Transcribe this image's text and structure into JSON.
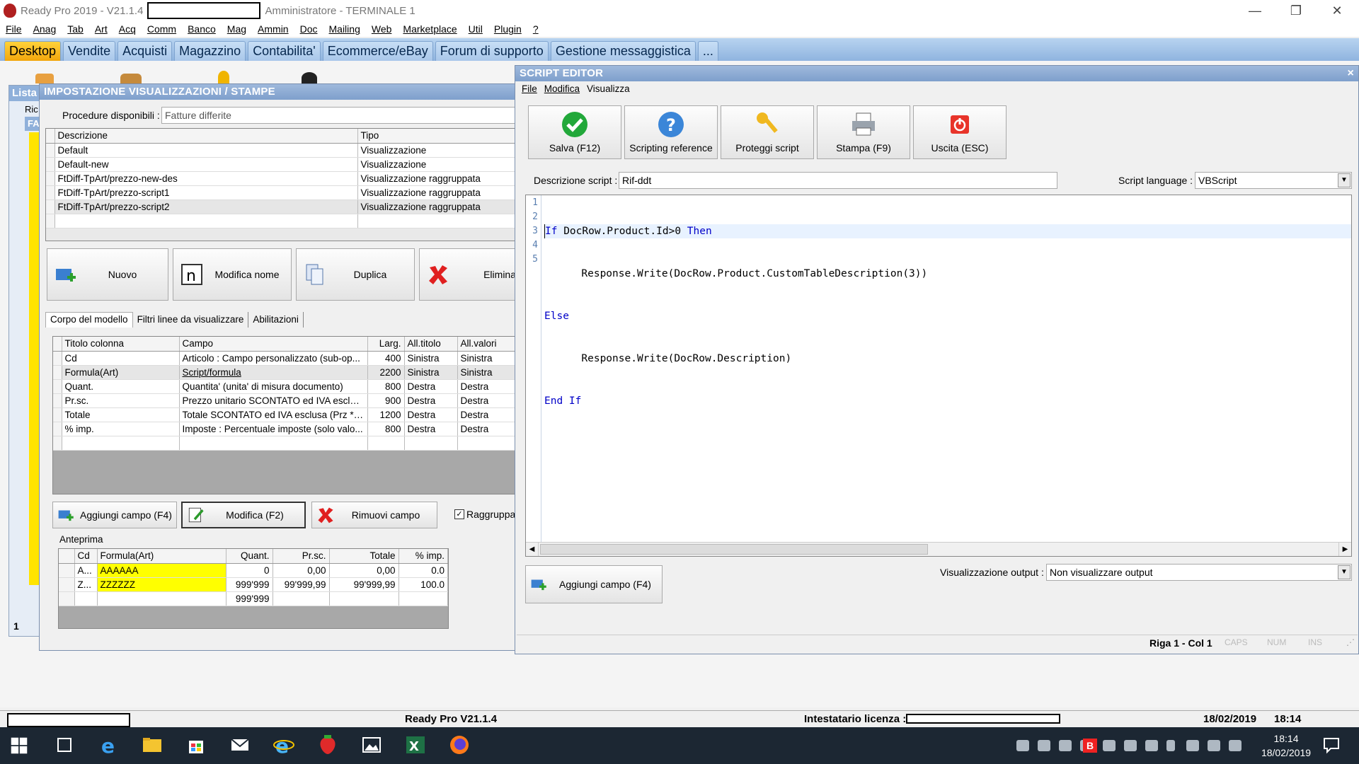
{
  "app": {
    "title": "Ready Pro 2019 - V21.1.4",
    "user_terminal": "Amministratore - TERMINALE 1"
  },
  "menu": [
    "File",
    "Anag",
    "Tab",
    "Art",
    "Acq",
    "Comm",
    "Banco",
    "Mag",
    "Ammin",
    "Doc",
    "Mailing",
    "Web",
    "Marketplace",
    "Util",
    "Plugin",
    "?"
  ],
  "tabs": [
    "Desktop",
    "Vendite",
    "Acquisti",
    "Magazzino",
    "Contabilita'",
    "Ecommerce/eBay",
    "Forum di supporto",
    "Gestione messaggistica",
    "..."
  ],
  "bg_window": {
    "title_fragment": "Lista",
    "label1": "Ric",
    "label2": "FA",
    "counter": "1"
  },
  "settings_window": {
    "title": "IMPOSTAZIONE VISUALIZZAZIONI / STAMPE",
    "procedures_label": "Procedure disponibili :",
    "procedures_value": "Fatture differite",
    "models_headers": [
      "Descrizione",
      "Tipo"
    ],
    "models": [
      {
        "desc": "Default",
        "type": "Visualizzazione"
      },
      {
        "desc": "Default-new",
        "type": "Visualizzazione"
      },
      {
        "desc": "FtDiff-TpArt/prezzo-new-des",
        "type": "Visualizzazione raggruppata"
      },
      {
        "desc": "FtDiff-TpArt/prezzo-script1",
        "type": "Visualizzazione raggruppata"
      },
      {
        "desc": "FtDiff-TpArt/prezzo-script2",
        "type": "Visualizzazione raggruppata"
      }
    ],
    "buttons": {
      "new": "Nuovo",
      "rename": "Modifica nome",
      "duplicate": "Duplica",
      "delete": "Elimina"
    },
    "subtabs": [
      "Corpo del modello",
      "Filtri linee da visualizzare",
      "Abilitazioni"
    ],
    "columns_headers": [
      "Titolo colonna",
      "Campo",
      "Larg.",
      "All.titolo",
      "All.valori"
    ],
    "columns": [
      {
        "title": "Cd",
        "field": "Articolo : Campo personalizzato (sub-op...",
        "width": "400",
        "align_title": "Sinistra",
        "align_values": "Sinistra"
      },
      {
        "title": "Formula(Art)",
        "field": "Script/formula",
        "width": "2200",
        "align_title": "Sinistra",
        "align_values": "Sinistra"
      },
      {
        "title": "Quant.",
        "field": "Quantita' (unita' di misura documento)",
        "width": "800",
        "align_title": "Destra",
        "align_values": "Destra"
      },
      {
        "title": "Pr.sc.",
        "field": "Prezzo unitario SCONTATO ed IVA esclusa",
        "width": "900",
        "align_title": "Destra",
        "align_values": "Destra"
      },
      {
        "title": "Totale",
        "field": "Totale SCONTATO ed IVA esclusa (Prz * ...",
        "width": "1200",
        "align_title": "Destra",
        "align_values": "Destra"
      },
      {
        "title": "% imp.",
        "field": "Imposte : Percentuale imposte (solo valo...",
        "width": "800",
        "align_title": "Destra",
        "align_values": "Destra"
      }
    ],
    "field_buttons": {
      "add": "Aggiungi campo (F4)",
      "edit": "Modifica (F2)",
      "remove": "Rimuovi campo"
    },
    "group_checkbox": "Raggruppa",
    "preview_label": "Anteprima",
    "preview_headers": [
      "Cd",
      "Formula(Art)",
      "Quant.",
      "Pr.sc.",
      "Totale",
      "% imp."
    ],
    "preview_rows": [
      {
        "cd": "A...",
        "formula": "AAAAAA",
        "quant": "0",
        "prsc": "0,00",
        "totale": "0,00",
        "imp": "0.0"
      },
      {
        "cd": "Z...",
        "formula": "ZZZZZZ",
        "quant": "999'999",
        "prsc": "99'999,99",
        "totale": "99'999,99",
        "imp": "100.0"
      }
    ],
    "preview_total_quant": "999'999"
  },
  "script_editor": {
    "title": "SCRIPT EDITOR",
    "close": "×",
    "menu": [
      "File",
      "Modifica",
      "Visualizza"
    ],
    "toolbar": {
      "save": "Salva (F12)",
      "reference": "Scripting reference",
      "protect": "Proteggi script",
      "print": "Stampa (F9)",
      "exit": "Uscita (ESC)"
    },
    "desc_label": "Descrizione script :",
    "desc_value": "Rif-ddt",
    "lang_label": "Script language :",
    "lang_value": "VBScript",
    "line_numbers": [
      "1",
      "2",
      "3",
      "4",
      "5"
    ],
    "code": {
      "l1_kw1": "If",
      "l1_mid": " DocRow.Product.Id>0 ",
      "l1_kw2": "Then",
      "l2": "      Response.Write(DocRow.Product.CustomTableDescription(3))",
      "l3_kw": "Else",
      "l4": "      Response.Write(DocRow.Description)",
      "l5_kw": "End If"
    },
    "add_field": "Aggiungi campo (F4)",
    "output_label": "Visualizzazione output :",
    "output_value": "Non visualizzare output",
    "status": {
      "pos": "Riga 1 - Col 1",
      "caps": "CAPS",
      "num": "NUM",
      "ins": "INS"
    },
    "colors": {
      "keyword": "#0000c8",
      "highlight": "#e8f2ff"
    }
  },
  "statusbar": {
    "version": "Ready Pro V21.1.4",
    "license_label": "Intestatario licenza :",
    "date": "18/02/2019",
    "time": "18:14"
  },
  "taskbar": {
    "time": "18:14",
    "date": "18/02/2019"
  }
}
